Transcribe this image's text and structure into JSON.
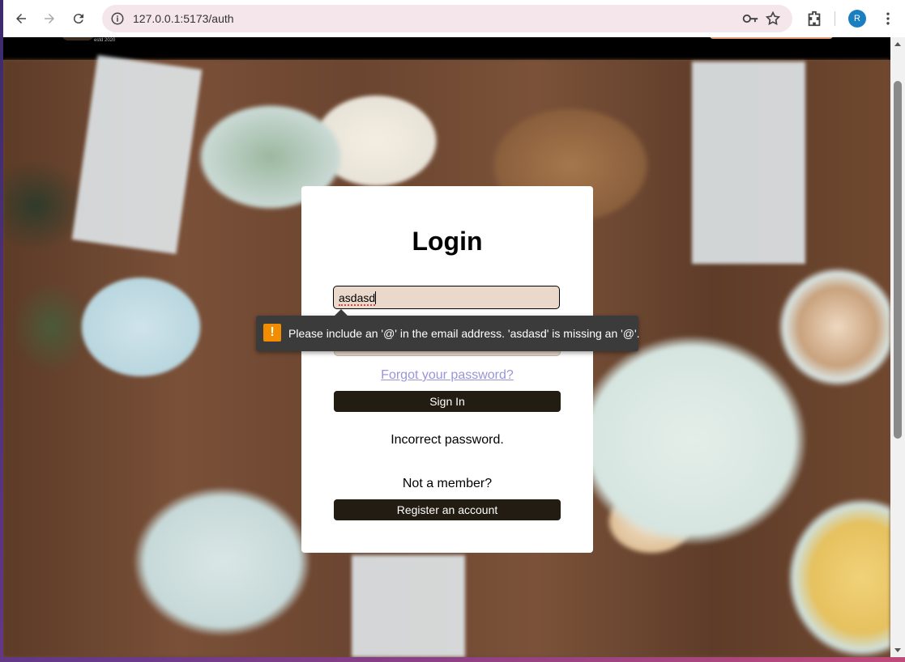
{
  "browser": {
    "url": "127.0.0.1:5173/auth",
    "profile_initial": "R"
  },
  "site_header": {
    "est_text": "estd 2020"
  },
  "login": {
    "title": "Login",
    "email_value": "asdasd",
    "forgot_password": "Forgot your password?",
    "sign_in_label": "Sign In",
    "error_message": "Incorrect password.",
    "not_member": "Not a member?",
    "register_label": "Register an account"
  },
  "validation_tooltip": {
    "icon": "!",
    "message": "Please include an '@' in the email address. 'asdasd' is missing an '@'."
  },
  "colors": {
    "button_bg": "#221c12",
    "input_bg": "#ead8ca",
    "link": "#9a94d8",
    "warning": "#f28c00"
  }
}
